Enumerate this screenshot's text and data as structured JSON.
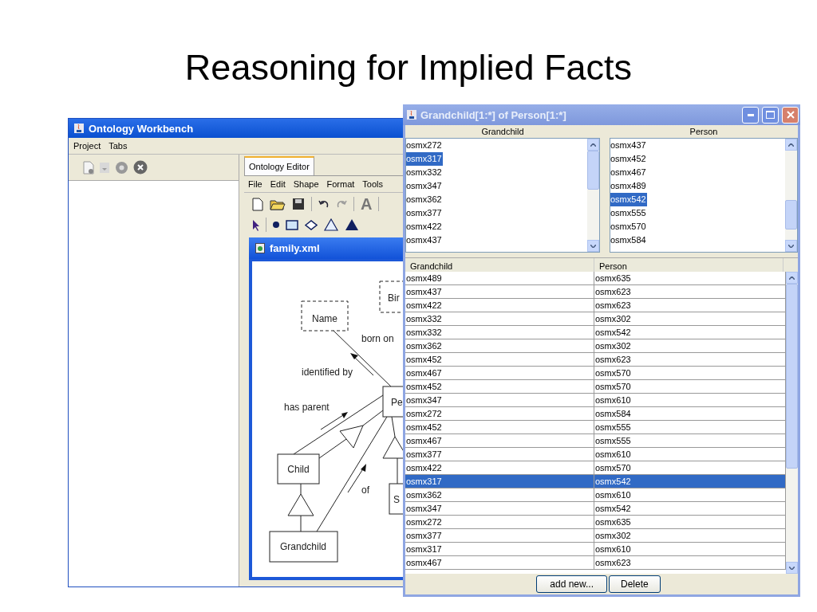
{
  "slide_title": "Reasoning for Implied Facts",
  "workbench": {
    "title": "Ontology Workbench",
    "menu": [
      "Project",
      "Tabs"
    ],
    "editor_tab": {
      "label": "Ontology Editor",
      "selected": true
    },
    "editor_menu": [
      "File",
      "Edit",
      "Shape",
      "Format",
      "Tools"
    ],
    "text_tool": "A",
    "document": {
      "title": "family.xml",
      "nodes": [
        {
          "label": "Name",
          "kind": "lexical"
        },
        {
          "label": "Bir",
          "kind": "lexical"
        },
        {
          "label": "Pe",
          "kind": "object"
        },
        {
          "label": "Child",
          "kind": "object"
        },
        {
          "label": "Grandchild",
          "kind": "object"
        },
        {
          "label": "S",
          "kind": "object"
        }
      ],
      "edge_labels": [
        "born on",
        "identified by",
        "has parent",
        "of"
      ]
    }
  },
  "dialog": {
    "title": "Grandchild[1:*] of Person[1:*]",
    "lists": [
      {
        "header": "Grandchild",
        "items": [
          {
            "label": "osmx272",
            "selected": false
          },
          {
            "label": "osmx317",
            "selected": true
          },
          {
            "label": "osmx332",
            "selected": false
          },
          {
            "label": "osmx347",
            "selected": false
          },
          {
            "label": "osmx362",
            "selected": false
          },
          {
            "label": "osmx377",
            "selected": false
          },
          {
            "label": "osmx422",
            "selected": false
          },
          {
            "label": "osmx437",
            "selected": false
          }
        ]
      },
      {
        "header": "Person",
        "items": [
          {
            "label": "osmx437",
            "selected": false
          },
          {
            "label": "osmx452",
            "selected": false
          },
          {
            "label": "osmx467",
            "selected": false
          },
          {
            "label": "osmx489",
            "selected": false
          },
          {
            "label": "osmx542",
            "selected": true
          },
          {
            "label": "osmx555",
            "selected": false
          },
          {
            "label": "osmx570",
            "selected": false
          },
          {
            "label": "osmx584",
            "selected": false
          }
        ]
      }
    ],
    "table": {
      "columns": [
        "Grandchild",
        "Person"
      ],
      "rows": [
        {
          "cells": [
            "osmx489",
            "osmx635"
          ],
          "selected": false
        },
        {
          "cells": [
            "osmx437",
            "osmx623"
          ],
          "selected": false
        },
        {
          "cells": [
            "osmx422",
            "osmx623"
          ],
          "selected": false
        },
        {
          "cells": [
            "osmx332",
            "osmx302"
          ],
          "selected": false
        },
        {
          "cells": [
            "osmx332",
            "osmx542"
          ],
          "selected": false
        },
        {
          "cells": [
            "osmx362",
            "osmx302"
          ],
          "selected": false
        },
        {
          "cells": [
            "osmx452",
            "osmx623"
          ],
          "selected": false
        },
        {
          "cells": [
            "osmx467",
            "osmx570"
          ],
          "selected": false
        },
        {
          "cells": [
            "osmx452",
            "osmx570"
          ],
          "selected": false
        },
        {
          "cells": [
            "osmx347",
            "osmx610"
          ],
          "selected": false
        },
        {
          "cells": [
            "osmx272",
            "osmx584"
          ],
          "selected": false
        },
        {
          "cells": [
            "osmx452",
            "osmx555"
          ],
          "selected": false
        },
        {
          "cells": [
            "osmx467",
            "osmx555"
          ],
          "selected": false
        },
        {
          "cells": [
            "osmx377",
            "osmx610"
          ],
          "selected": false
        },
        {
          "cells": [
            "osmx422",
            "osmx570"
          ],
          "selected": false
        },
        {
          "cells": [
            "osmx317",
            "osmx542"
          ],
          "selected": true
        },
        {
          "cells": [
            "osmx362",
            "osmx610"
          ],
          "selected": false
        },
        {
          "cells": [
            "osmx347",
            "osmx542"
          ],
          "selected": false
        },
        {
          "cells": [
            "osmx272",
            "osmx635"
          ],
          "selected": false
        },
        {
          "cells": [
            "osmx377",
            "osmx302"
          ],
          "selected": false
        },
        {
          "cells": [
            "osmx317",
            "osmx610"
          ],
          "selected": false
        },
        {
          "cells": [
            "osmx467",
            "osmx623"
          ],
          "selected": false
        }
      ]
    },
    "buttons": [
      "add new...",
      "Delete"
    ]
  }
}
